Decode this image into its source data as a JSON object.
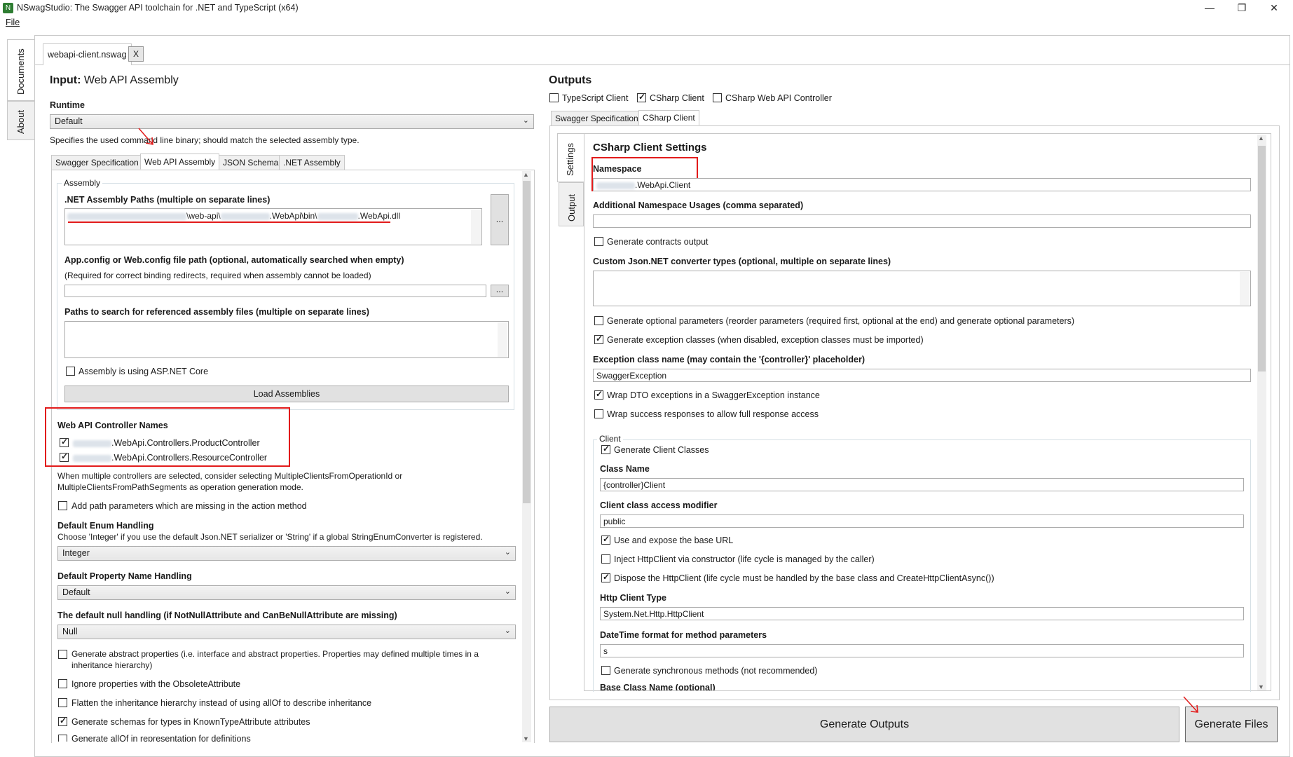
{
  "window": {
    "title": "NSwagStudio: The Swagger API toolchain for .NET and TypeScript (x64)",
    "menu_file": "File",
    "minimize": "—",
    "maximize": "❐",
    "close": "✕"
  },
  "side_tabs": {
    "documents": "Documents",
    "about": "About"
  },
  "document_tab": {
    "label": "webapi-client.nswag",
    "close": "X"
  },
  "input": {
    "heading_bold": "Input:",
    "heading_rest": "Web API Assembly",
    "runtime_label": "Runtime",
    "runtime_value": "Default",
    "runtime_hint": "Specifies the used command line binary; should match the selected assembly type.",
    "tabs": [
      "Swagger Specification",
      "Web API Assembly",
      "JSON Schema",
      ".NET Assembly"
    ],
    "assembly_group": "Assembly",
    "assembly_paths_label": ".NET Assembly Paths (multiple on separate lines)",
    "assembly_path_seg1": "\\web-api\\",
    "assembly_path_seg2": ".WebApi\\bin\\",
    "assembly_path_seg3": ".WebApi.dll",
    "browse": "...",
    "config_label": "App.config or Web.config file path (optional, automatically searched when empty)",
    "config_hint": "(Required for correct binding redirects, required when assembly cannot be loaded)",
    "ref_paths_label": "Paths to search for referenced assembly files (multiple on separate lines)",
    "aspnetcore": "Assembly is using ASP.NET Core",
    "load_button": "Load Assemblies",
    "controllers_label": "Web API Controller Names",
    "controller1": ".WebApi.Controllers.ProductController",
    "controller2": ".WebApi.Controllers.ResourceController",
    "multi_hint1": "When multiple controllers are selected, consider selecting MultipleClientsFromOperationId or",
    "multi_hint2": "MultipleClientsFromPathSegments as operation generation mode.",
    "add_path_params": "Add path parameters which are missing in the action method",
    "enum_label": "Default Enum Handling",
    "enum_hint": "Choose 'Integer' if you use the default Json.NET serializer or 'String' if a global StringEnumConverter is registered.",
    "enum_value": "Integer",
    "prop_label": "Default Property Name Handling",
    "prop_value": "Default",
    "null_label": "The default null handling (if NotNullAttribute and CanBeNullAttribute are missing)",
    "null_value": "Null",
    "abstract_props1": "Generate abstract properties (i.e. interface and abstract properties. Properties may defined multiple times in a",
    "abstract_props2": "inheritance hierarchy)",
    "ignore_obsolete": "Ignore properties with the ObsoleteAttribute",
    "flatten": "Flatten the inheritance hierarchy instead of using allOf to describe inheritance",
    "known_types": "Generate schemas for types in KnownTypeAttribute attributes",
    "cut_text": "Generate allOf in representation for definitions"
  },
  "outputs": {
    "heading": "Outputs",
    "ts_client": "TypeScript Client",
    "cs_client": "CSharp Client",
    "cs_controller": "CSharp Web API Controller",
    "tabs": [
      "Swagger Specification",
      "CSharp Client"
    ],
    "vtab_settings": "Settings",
    "vtab_output": "Output",
    "settings_heading": "CSharp Client Settings",
    "namespace_label": "Namespace",
    "namespace_value": ".WebApi.Client",
    "add_ns_label": "Additional Namespace Usages (comma separated)",
    "contracts": "Generate contracts output",
    "converters_label": "Custom Json.NET converter types (optional, multiple on separate lines)",
    "optional_params": "Generate optional parameters (reorder parameters (required first, optional at the end) and generate optional parameters)",
    "exception_classes": "Generate exception classes (when disabled, exception classes must be imported)",
    "exception_name_label": "Exception class name (may contain the '{controller}' placeholder)",
    "exception_name_value": "SwaggerException",
    "wrap_dto": "Wrap DTO exceptions in a SwaggerException instance",
    "wrap_success": "Wrap success responses to allow full response access",
    "client_group": "Client",
    "gen_client_classes": "Generate Client Classes",
    "class_name_label": "Class Name",
    "class_name_value": "{controller}Client",
    "access_label": "Client class access modifier",
    "access_value": "public",
    "base_url": "Use and expose the base URL",
    "inject_http": "Inject HttpClient via constructor (life cycle is managed by the caller)",
    "dispose_http": "Dispose the HttpClient (life cycle must be handled by the base class and CreateHttpClientAsync())",
    "http_type_label": "Http Client Type",
    "http_type_value": "System.Net.Http.HttpClient",
    "datetime_label": "DateTime format for method parameters",
    "datetime_value": "s",
    "sync_methods": "Generate synchronous methods (not recommended)",
    "base_class_label": "Base Class Name (optional)"
  },
  "buttons": {
    "generate_outputs": "Generate Outputs",
    "generate_files": "Generate Files"
  }
}
